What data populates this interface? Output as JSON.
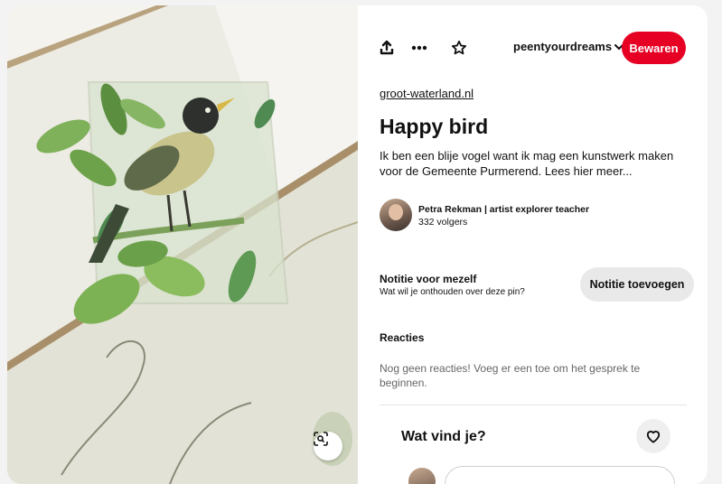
{
  "toolbar": {
    "share_icon": "share-upload-icon",
    "more_icon": "ellipsis-icon",
    "favorite_icon": "star-outline-icon",
    "board_name": "peentyourdreams",
    "board_chevron": "chevron-down-icon",
    "save_label": "Bewaren",
    "save_color": "#e60023"
  },
  "pin": {
    "source_link": "groot-waterland.nl",
    "title": "Happy bird",
    "description": "Ik ben een blije vogel want ik mag een kunstwerk maken voor de Gemeente Purmerend. Lees hier meer..."
  },
  "creator": {
    "name": "Petra Rekman | artist explorer teacher",
    "followers": "332 volgers"
  },
  "note": {
    "title": "Notitie voor mezelf",
    "subtitle": "Wat wil je onthouden over deze pin?",
    "button_label": "Notitie toevoegen"
  },
  "comments": {
    "title": "Reacties",
    "empty_text": "Nog geen reacties! Voeg er een toe om het gesprek te beginnen."
  },
  "reaction": {
    "question": "Wat vind je?",
    "icon": "heart-outline-icon"
  },
  "image": {
    "visual_search_icon": "visual-search-icon"
  }
}
